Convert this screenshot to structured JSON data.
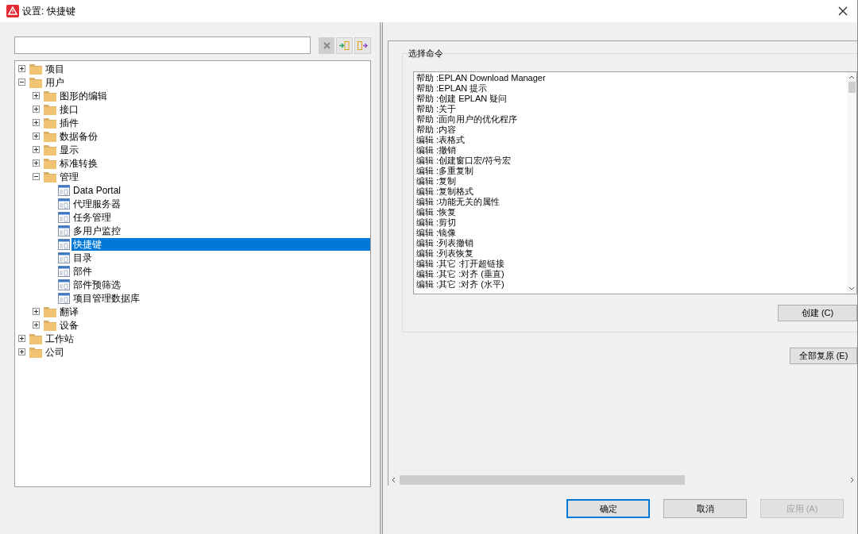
{
  "window": {
    "title": "设置: 快捷键"
  },
  "tree": [
    {
      "label": "项目",
      "kind": "folder",
      "expanded": false,
      "selected": false
    },
    {
      "label": "用户",
      "kind": "folder",
      "expanded": true,
      "selected": false,
      "children": [
        {
          "label": "图形的编辑",
          "kind": "folder",
          "expanded": false,
          "selected": false
        },
        {
          "label": "接口",
          "kind": "folder",
          "expanded": false,
          "selected": false
        },
        {
          "label": "插件",
          "kind": "folder",
          "expanded": false,
          "selected": false
        },
        {
          "label": "数据备份",
          "kind": "folder",
          "expanded": false,
          "selected": false
        },
        {
          "label": "显示",
          "kind": "folder",
          "expanded": false,
          "selected": false
        },
        {
          "label": "标准转换",
          "kind": "folder",
          "expanded": false,
          "selected": false
        },
        {
          "label": "管理",
          "kind": "folder",
          "expanded": true,
          "selected": false,
          "children": [
            {
              "label": "Data Portal",
              "kind": "page",
              "selected": false
            },
            {
              "label": "代理服务器",
              "kind": "page",
              "selected": false
            },
            {
              "label": "任务管理",
              "kind": "page",
              "selected": false
            },
            {
              "label": "多用户监控",
              "kind": "page",
              "selected": false
            },
            {
              "label": "快捷键",
              "kind": "page",
              "selected": true
            },
            {
              "label": "目录",
              "kind": "page",
              "selected": false
            },
            {
              "label": "部件",
              "kind": "page",
              "selected": false
            },
            {
              "label": "部件预筛选",
              "kind": "page",
              "selected": false
            },
            {
              "label": "项目管理数据库",
              "kind": "page",
              "selected": false
            }
          ]
        },
        {
          "label": "翻译",
          "kind": "folder",
          "expanded": false,
          "selected": false
        },
        {
          "label": "设备",
          "kind": "folder",
          "expanded": false,
          "selected": false
        }
      ]
    },
    {
      "label": "工作站",
      "kind": "folder",
      "expanded": false,
      "selected": false
    },
    {
      "label": "公司",
      "kind": "folder",
      "expanded": false,
      "selected": false
    }
  ],
  "command_group": {
    "title": "选择命令",
    "commands": [
      "帮助 :EPLAN Download Manager",
      "帮助 :EPLAN 提示",
      "帮助 :创建 EPLAN 疑问",
      "帮助 :关于",
      "帮助 :面向用户的优化程序",
      "帮助 :内容",
      "编辑 :表格式",
      "编辑 :撤销",
      "编辑 :创建窗口宏/符号宏",
      "编辑 :多重复制",
      "编辑 :复制",
      "编辑 :复制格式",
      "编辑 :功能无关的属性",
      "编辑 :恢复",
      "编辑 :剪切",
      "编辑 :镜像",
      "编辑 :列表撤销",
      "编辑 :列表恢复",
      "编辑 :其它 :打开超链接",
      "编辑 :其它 :对齐 (垂直)",
      "编辑 :其它 :对齐 (水平)"
    ],
    "create_button": "创建 (C)"
  },
  "reset_all_button": "全部复原 (E)",
  "buttons": [
    {
      "label": "确定",
      "default": true,
      "disabled": false
    },
    {
      "label": "取消",
      "default": false,
      "disabled": false
    },
    {
      "label": "应用 (A)",
      "default": false,
      "disabled": true
    }
  ]
}
